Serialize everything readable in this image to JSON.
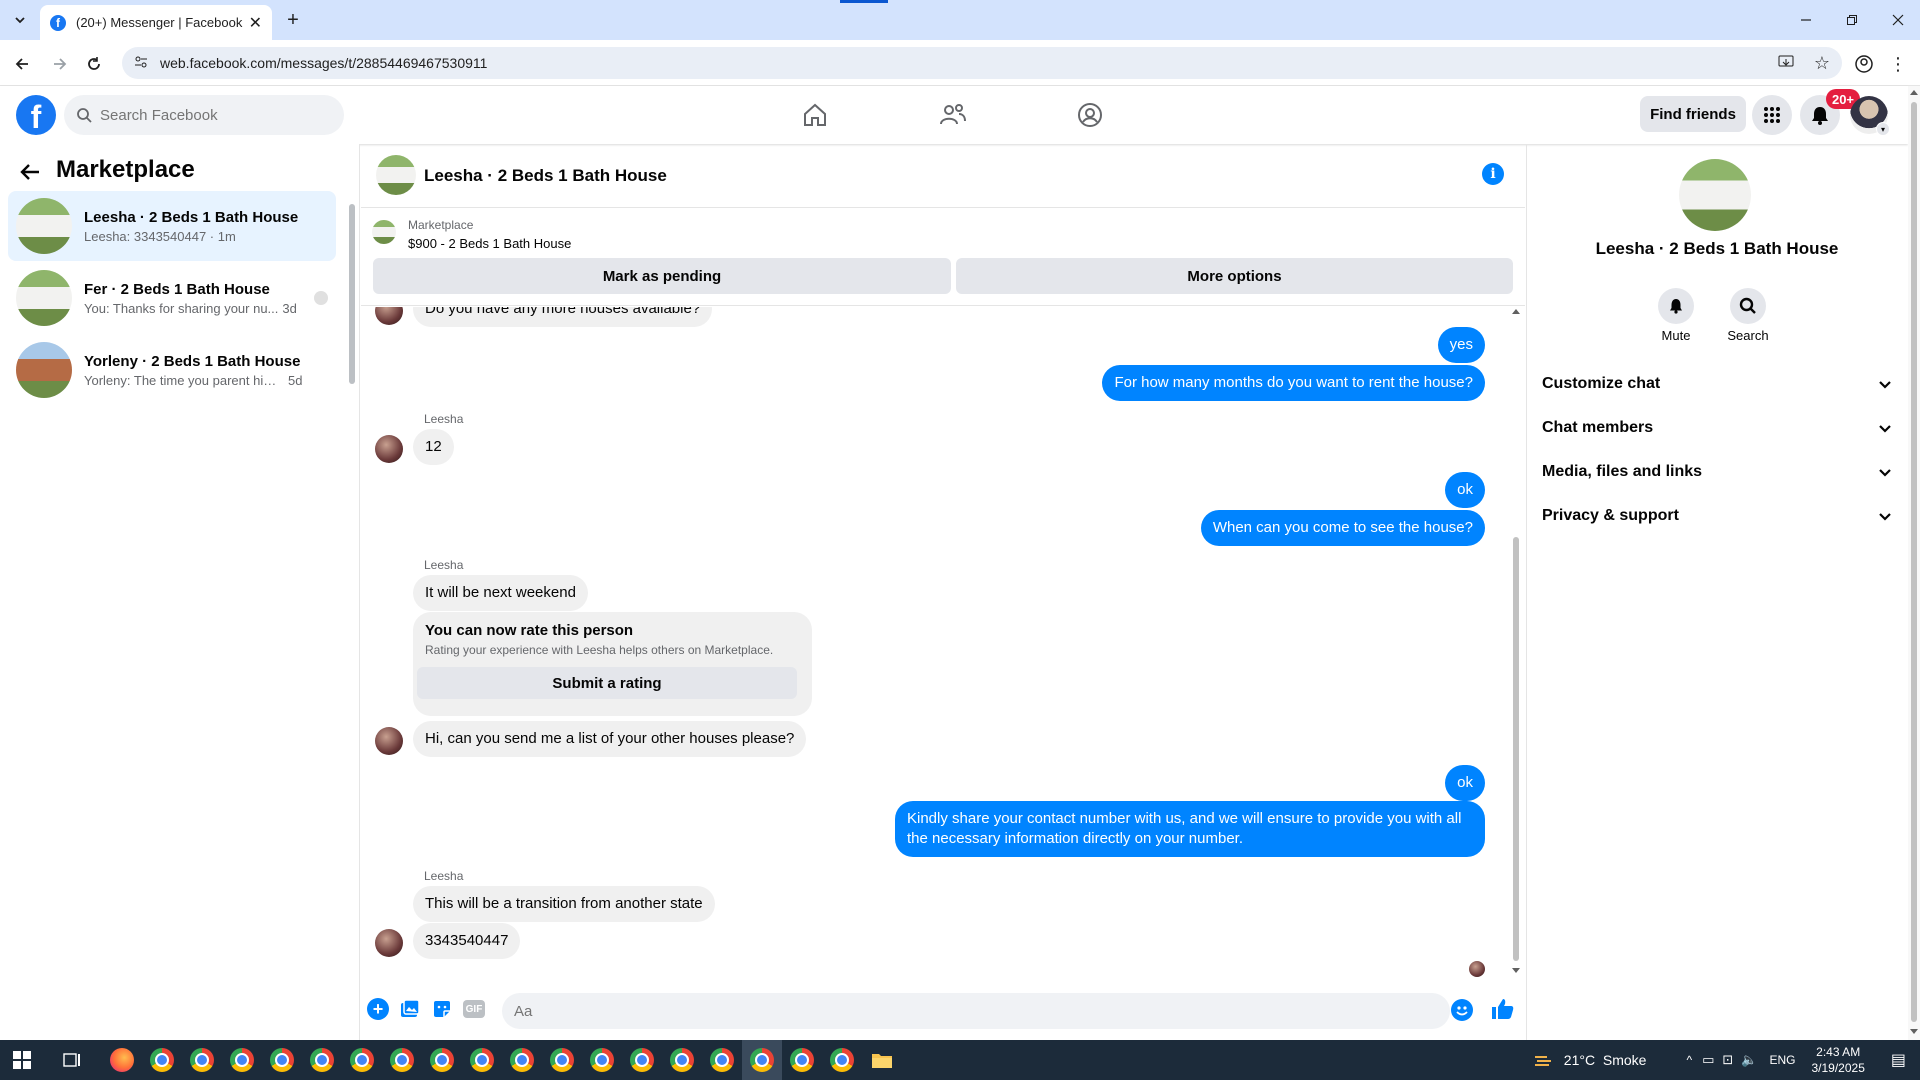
{
  "browser": {
    "tab_title": "(20+) Messenger | Facebook",
    "url": "web.facebook.com/messages/t/28854469467530911"
  },
  "fb": {
    "search_placeholder": "Search Facebook",
    "find_friends": "Find friends",
    "notif_count": "20+",
    "brand_color": "#1877f2"
  },
  "left": {
    "title": "Marketplace",
    "conversations": [
      {
        "name": "Leesha · 2 Beds 1 Bath House",
        "preview": "Leesha: 3343540447 · 1m",
        "time": ""
      },
      {
        "name": "Fer · 2 Beds 1 Bath House",
        "preview": "You: Thanks for sharing your nu...",
        "time": "3d"
      },
      {
        "name": "Yorleny · 2 Beds 1 Bath House",
        "preview": "Yorleny: The time you parent him t...",
        "time": "5d"
      }
    ]
  },
  "chat": {
    "title": "Leesha · 2 Beds 1 Bath House",
    "banner_label": "Marketplace",
    "banner_listing": "$900 - 2 Beds 1 Bath House",
    "mark_pending": "Mark as pending",
    "more_options": "More options",
    "partial_top": "Do you have any more houses available?",
    "messages": {
      "m1": "yes",
      "m2": "For how many months do you want to rent the house?",
      "s1": "Leesha",
      "m3": "12",
      "m4": "ok",
      "m5": "When can you come to see the house?",
      "s2": "Leesha",
      "m6": "It will be next weekend",
      "m7": "Hi, can you send me a list of your other houses please?",
      "m8": "ok",
      "m9": "Kindly share your contact number with us, and we will ensure to provide you with all the necessary information directly on your number.",
      "s3": "Leesha",
      "m10": "This will be a transition from another state",
      "m11": "3343540447"
    },
    "rate": {
      "title": "You can now rate this person",
      "desc": "Rating your experience with Leesha helps others on Marketplace.",
      "button": "Submit a rating"
    },
    "composer_placeholder": "Aa",
    "gif_label": "GIF"
  },
  "right": {
    "name": "Leesha · 2 Beds 1 Bath House",
    "mute": "Mute",
    "search": "Search",
    "sections": [
      "Customize chat",
      "Chat members",
      "Media, files and links",
      "Privacy & support"
    ]
  },
  "taskbar": {
    "weather": "21°C  Smoke",
    "lang": "ENG",
    "time": "2:43 AM",
    "date": "3/19/2025"
  }
}
